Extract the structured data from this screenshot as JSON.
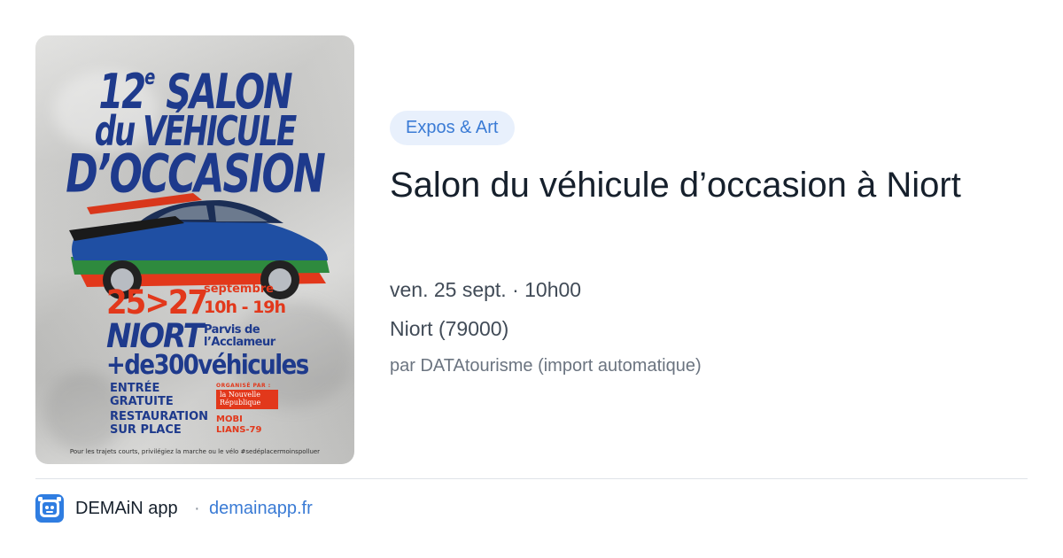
{
  "card": {
    "category": "Expos & Art",
    "title": "Salon du véhicule d’occasion à Niort",
    "datetime": "ven. 25 sept. · 10h00",
    "location": "Niort (79000)",
    "source": "par DATAtourisme (import automatique)"
  },
  "poster": {
    "title_line1_num": "12",
    "title_line1_sup": "e",
    "title_line1_word": "SALON",
    "title_line2": "du VÉHICULE",
    "title_line3": "D’OCCASION",
    "dates": "25>27",
    "month": "septembre",
    "hours": "10h - 19h",
    "city": "NIORT",
    "venue_line1": "Parvis de",
    "venue_line2": "l’Acclameur",
    "vehicles": "+de300véhicules",
    "entry_line1": "ENTRÉE",
    "entry_line2": "GRATUITE",
    "food_line1": "RESTAURATION",
    "food_line2": "SUR PLACE",
    "organised_by": "ORGANISÉ PAR :",
    "sponsor1_line1": "la Nouvelle",
    "sponsor1_line2": "République",
    "sponsor2_line1": "MOBI",
    "sponsor2_line2": "LIANS-79",
    "footer": "Pour les trajets courts, privilégiez la marche ou le vélo #sedéplacermoinspolluer"
  },
  "footer": {
    "app_name": "DEMAiN app",
    "separator": "·",
    "domain": "demainapp.fr"
  },
  "colors": {
    "accent": "#3a7bd5",
    "chip_bg": "#e8f0fc",
    "poster_blue": "#1e3a8c",
    "poster_red": "#e2381b"
  }
}
